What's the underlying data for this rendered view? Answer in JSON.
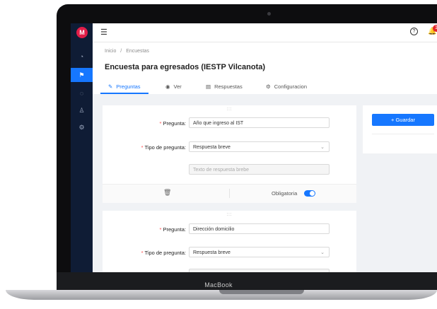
{
  "device": {
    "brand_label": "MacBook"
  },
  "sidebar": {
    "logo": "M",
    "items": [
      {
        "icon": "dashboard-icon",
        "glyph": "◔",
        "active": false
      },
      {
        "icon": "flag-icon",
        "glyph": "⚑",
        "active": true
      },
      {
        "icon": "chat-icon",
        "glyph": "◌",
        "active": false
      },
      {
        "icon": "user-icon",
        "glyph": "♙",
        "active": false
      },
      {
        "icon": "settings-icon",
        "glyph": "⚙",
        "active": false
      }
    ]
  },
  "topbar": {
    "menu_icon": "☰",
    "help_icon": "?",
    "bell_icon": "🔔",
    "notification_count": "1",
    "apps_icon": "⋮⋮⋮"
  },
  "breadcrumb": {
    "home": "Inicio",
    "separator": "/",
    "current": "Encuestas"
  },
  "page": {
    "title": "Encuesta para egresados (IESTP Vilcanota)"
  },
  "tabs": [
    {
      "icon": "✎",
      "label": "Preguntas"
    },
    {
      "icon": "◉",
      "label": "Ver"
    },
    {
      "icon": "▤",
      "label": "Respuestas"
    },
    {
      "icon": "⚙",
      "label": "Configuracion"
    }
  ],
  "questions": [
    {
      "drag": ":::",
      "question_label": "Pregunta:",
      "question_value": "Año que ingreso al IST",
      "type_label": "Tipo de pregunta:",
      "type_value": "Respuesta breve",
      "answer_placeholder": "Texto de respuesta brebe",
      "trash_icon": "🗑",
      "required_label": "Obligatoria",
      "required_on": true
    },
    {
      "drag": ":::",
      "question_label": "Pregunta:",
      "question_value": "Dirección domicilio",
      "type_label": "Tipo de pregunta:",
      "type_value": "Respuesta breve"
    }
  ],
  "actions": {
    "save_label": "+  Guardar"
  },
  "colors": {
    "accent": "#1677ff",
    "sidebar": "#0f1c35",
    "badge": "#e5252a",
    "logo": "#e11d48"
  }
}
